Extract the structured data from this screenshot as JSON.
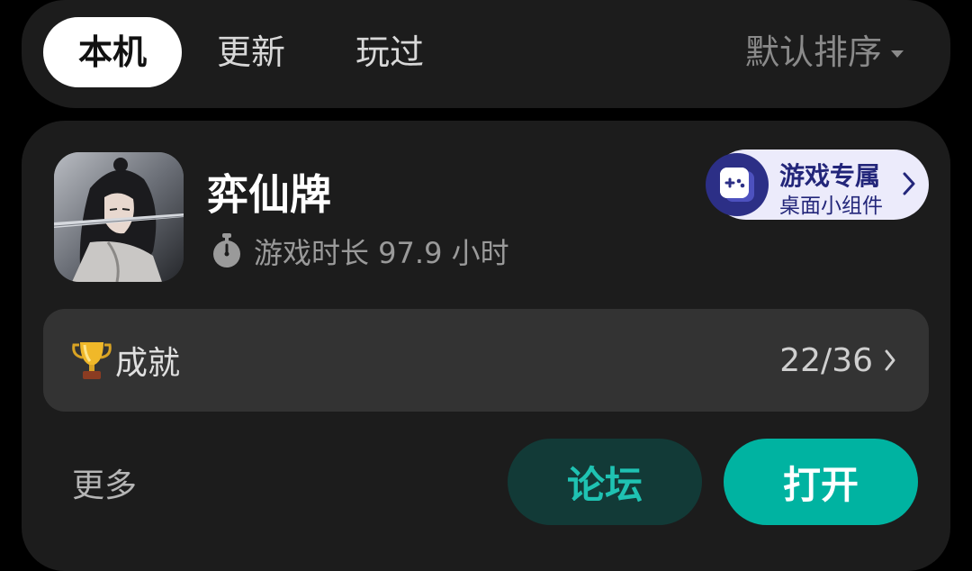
{
  "tabs": [
    {
      "label": "本机",
      "active": true
    },
    {
      "label": "更新",
      "active": false
    },
    {
      "label": "玩过",
      "active": false
    }
  ],
  "sort": {
    "label": "默认排序",
    "icon": "caret-down-icon"
  },
  "game": {
    "title": "弈仙牌",
    "playtime_icon": "stopwatch-icon",
    "playtime": "游戏时长 97.9 小时",
    "widget": {
      "line1": "游戏专属",
      "line2": "桌面小组件",
      "icon": "gamepad-icon"
    },
    "achievements": {
      "icon": "trophy-icon",
      "label": "成就",
      "progress": "22/36"
    },
    "more_label": "更多",
    "forum_label": "论坛",
    "open_label": "打开"
  },
  "colors": {
    "accent": "#00b3a1",
    "forum_bg": "#123a37",
    "widget_bg": "#ecebfb",
    "widget_text": "#23267a"
  }
}
